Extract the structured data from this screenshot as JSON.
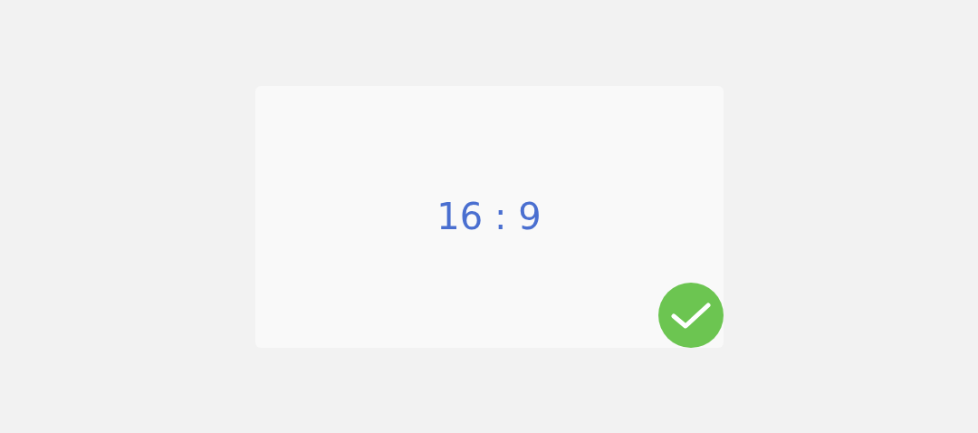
{
  "option": {
    "label": "16 : 9",
    "selected": true
  }
}
